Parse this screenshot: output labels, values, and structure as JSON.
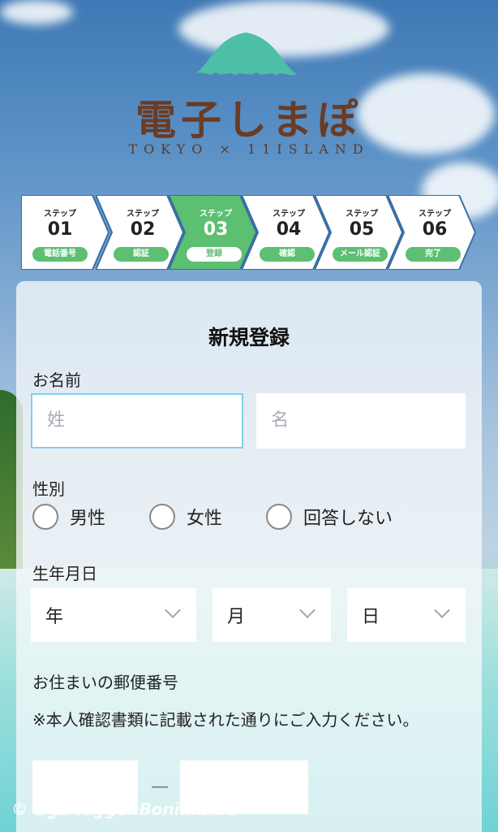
{
  "logo": {
    "name": "電子しまぽ",
    "subtitle": "TOKYO × 11ISLAND"
  },
  "steps": [
    {
      "label": "ステップ",
      "num": "01",
      "pill": "電話番号"
    },
    {
      "label": "ステップ",
      "num": "02",
      "pill": "認証"
    },
    {
      "label": "ステップ",
      "num": "03",
      "pill": "登録"
    },
    {
      "label": "ステップ",
      "num": "04",
      "pill": "確認"
    },
    {
      "label": "ステップ",
      "num": "05",
      "pill": "メール認証"
    },
    {
      "label": "ステップ",
      "num": "06",
      "pill": "完了"
    }
  ],
  "active_step": "03",
  "colors": {
    "accent": "#5cbf72",
    "focus": "#7fd1e6",
    "logo_brown": "#6b3b24",
    "logo_teal": "#4dbfa6"
  },
  "form": {
    "title": "新規登録",
    "name_label": "お名前",
    "last_name_placeholder": "姓",
    "first_name_placeholder": "名",
    "gender_label": "性別",
    "gender_options": [
      "男性",
      "女性",
      "回答しない"
    ],
    "birth_label": "生年月日",
    "year": "年",
    "month": "月",
    "day": "日",
    "zip_label": "お住まいの郵便番号",
    "zip_note": "※本人確認書類に記載された通りにご入力ください。",
    "zip_dash": "—"
  },
  "watermark": "© Oga-logger.Bonin.blue"
}
